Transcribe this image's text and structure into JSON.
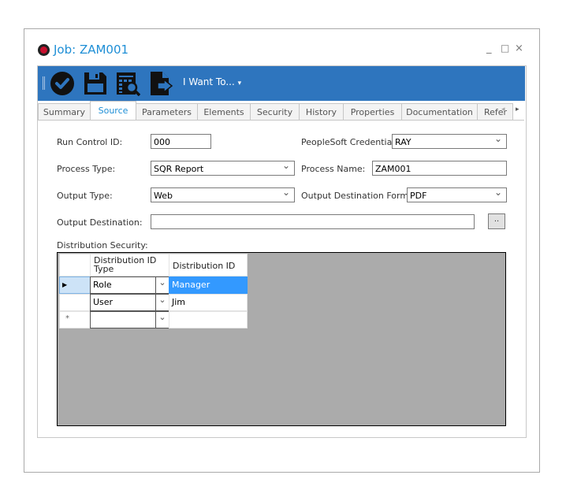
{
  "window": {
    "title": "Job: ZAM001",
    "controls": {
      "minimize": "_",
      "maximize": "□",
      "close": "×"
    }
  },
  "toolbar": {
    "icons": [
      "check-circle-icon",
      "save-icon",
      "view-report-icon",
      "export-icon"
    ],
    "menu_label": "I Want To...",
    "menu_caret": "▾",
    "accent": "#2e75be"
  },
  "tabs": {
    "items": [
      {
        "label": "Summary",
        "active": false
      },
      {
        "label": "Source",
        "active": true
      },
      {
        "label": "Parameters",
        "active": false
      },
      {
        "label": "Elements",
        "active": false
      },
      {
        "label": "Security",
        "active": false
      },
      {
        "label": "History",
        "active": false
      },
      {
        "label": "Properties",
        "active": false
      },
      {
        "label": "Documentation",
        "active": false
      },
      {
        "label": "Refer",
        "active": false
      }
    ],
    "scroll_left": "◂",
    "scroll_right": "▸"
  },
  "form": {
    "run_control_id": {
      "label": "Run Control ID:",
      "value": "000"
    },
    "peoplesoft_credential": {
      "label": "PeopleSoft Credential:",
      "value": "RAY"
    },
    "process_type": {
      "label": "Process Type:",
      "value": "SQR Report"
    },
    "process_name": {
      "label": "Process Name:",
      "value": "ZAM001"
    },
    "output_type": {
      "label": "Output Type:",
      "value": "Web"
    },
    "output_destination_format": {
      "label": "Output Destination Format:",
      "value": "PDF"
    },
    "output_destination": {
      "label": "Output Destination:",
      "value": "",
      "browse_label": ".."
    }
  },
  "distribution_security": {
    "label": "Distribution Security:",
    "columns": [
      "Distribution ID Type",
      "Distribution ID"
    ],
    "rows": [
      {
        "indicator": "▶",
        "type": "Role",
        "id": "Manager",
        "selected": true
      },
      {
        "indicator": "",
        "type": "User",
        "id": "Jim",
        "selected": false
      },
      {
        "indicator": "*",
        "type": "",
        "id": "",
        "selected": false
      }
    ]
  }
}
